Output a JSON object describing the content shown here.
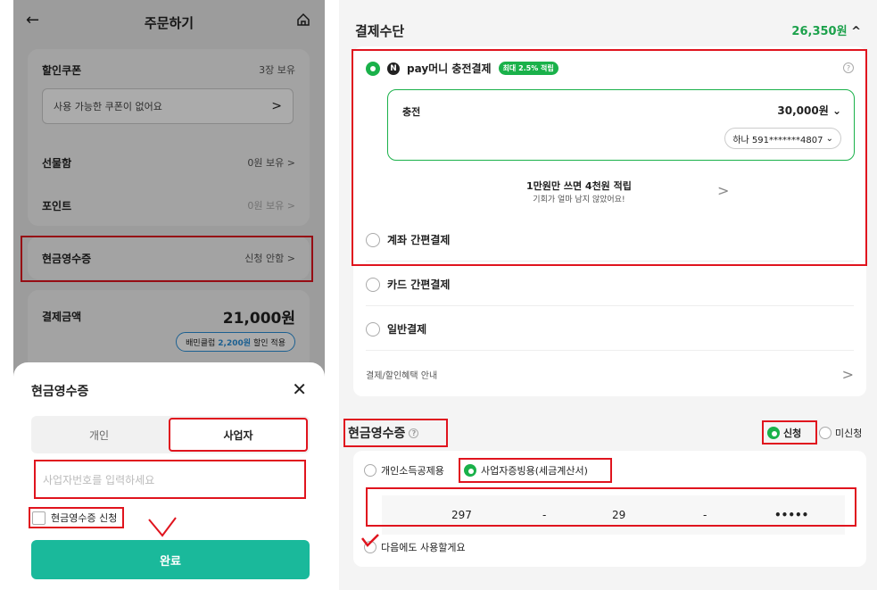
{
  "left": {
    "header": {
      "back_icon": "←",
      "title": "주문하기",
      "home_icon": "home-icon"
    },
    "coupon": {
      "label": "할인쿠폰",
      "count": "3장 보유",
      "box_text": "사용 가능한 쿠폰이 없어요",
      "chevron": ">"
    },
    "gift": {
      "label": "선물함",
      "value": "0원 보유 >"
    },
    "point": {
      "label": "포인트",
      "value": "0원 보유 >"
    },
    "cash_receipt": {
      "label": "현금영수증",
      "value": "신청 안함 >"
    },
    "payment": {
      "label": "결제금액",
      "amount": "21,000원",
      "badge_prefix": "배민클럽",
      "badge_amount": "2,200원",
      "badge_suffix": "할인 적용"
    },
    "sheet": {
      "title": "현금영수증",
      "close": "✕",
      "tabs": [
        "개인",
        "사업자"
      ],
      "biz_placeholder": "사업자번호를 입력하세요",
      "checkbox_label": "현금영수증 신청",
      "confirm_button": "완료"
    }
  },
  "right": {
    "title": "결제수단",
    "total": "26,350원",
    "caret": "^",
    "npay": {
      "n": "N",
      "label": "pay머니 충전결제",
      "badge": "최대 2.5% 적립",
      "help": "?"
    },
    "charge": {
      "label": "충전",
      "amount": "30,000원",
      "bank": "하나 591*******4807"
    },
    "promo": {
      "title": "1만원만 쓰면 4천원 적립",
      "sub": "기회가 얼마 남지 않았어요!",
      "chevron": ">"
    },
    "options": [
      "계좌 간편결제",
      "카드 간편결제",
      "일반결제"
    ],
    "benefit_link": "결제/할인혜택 안내",
    "benefit_chevron": ">",
    "cash_receipt": {
      "title": "현금영수증",
      "help": "?",
      "apply": "신청",
      "not_apply": "미신청",
      "opt_personal": "개인소득공제용",
      "opt_business": "사업자증빙용(세금계산서)",
      "biz_no": [
        "297",
        "-",
        "29",
        "-",
        "•••••"
      ],
      "remember": "다음에도 사용할게요"
    }
  },
  "colors": {
    "accent_green": "#1ab14a",
    "mint": "#1ab99b",
    "highlight_red": "#e0141e"
  }
}
